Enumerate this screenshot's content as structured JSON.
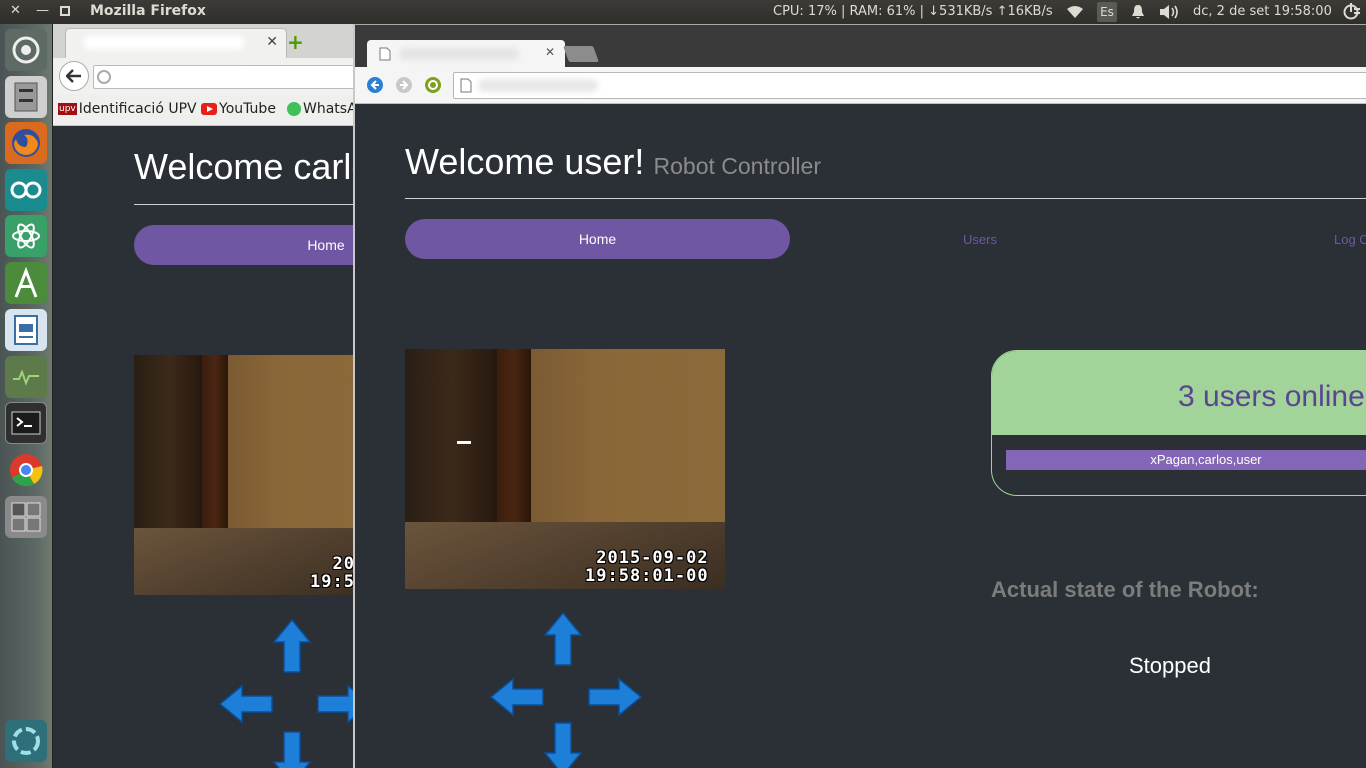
{
  "panel": {
    "app_title": "Mozilla Firefox",
    "system_monitor": "CPU: 17% | RAM: 61% | ↓531KB/s ↑16KB/s",
    "keyboard_layout": "Es",
    "clock": "dc,  2 de set 19:58:00"
  },
  "back_browser": {
    "bookmarks": [
      {
        "label": "Identificació UPV",
        "icon": "upv-icon"
      },
      {
        "label": "YouTube",
        "icon": "youtube-icon"
      },
      {
        "label": "WhatsA",
        "icon": "whatsapp-icon"
      }
    ],
    "page": {
      "welcome": "Welcome carlo",
      "nav_home": "Home",
      "cam_timestamp_date": "20",
      "cam_timestamp_time": "19:5"
    }
  },
  "front_browser": {
    "page": {
      "welcome": "Welcome user!",
      "subtitle": "Robot Controller",
      "nav": {
        "home": "Home",
        "users": "Users",
        "logout": "Log C"
      },
      "cam_timestamp_date": "2015-09-02",
      "cam_timestamp_time": "19:58:01-00",
      "users_online": "3 users online",
      "users_list": "xPagan,carlos,user",
      "state_title": "Actual state of the Robot:",
      "state_value": "Stopped"
    }
  },
  "colors": {
    "page_bg": "#2b2f36",
    "accent_purple": "#6f57a3",
    "users_box_green": "#a2d49a",
    "arrow_blue": "#1e7fd8"
  }
}
